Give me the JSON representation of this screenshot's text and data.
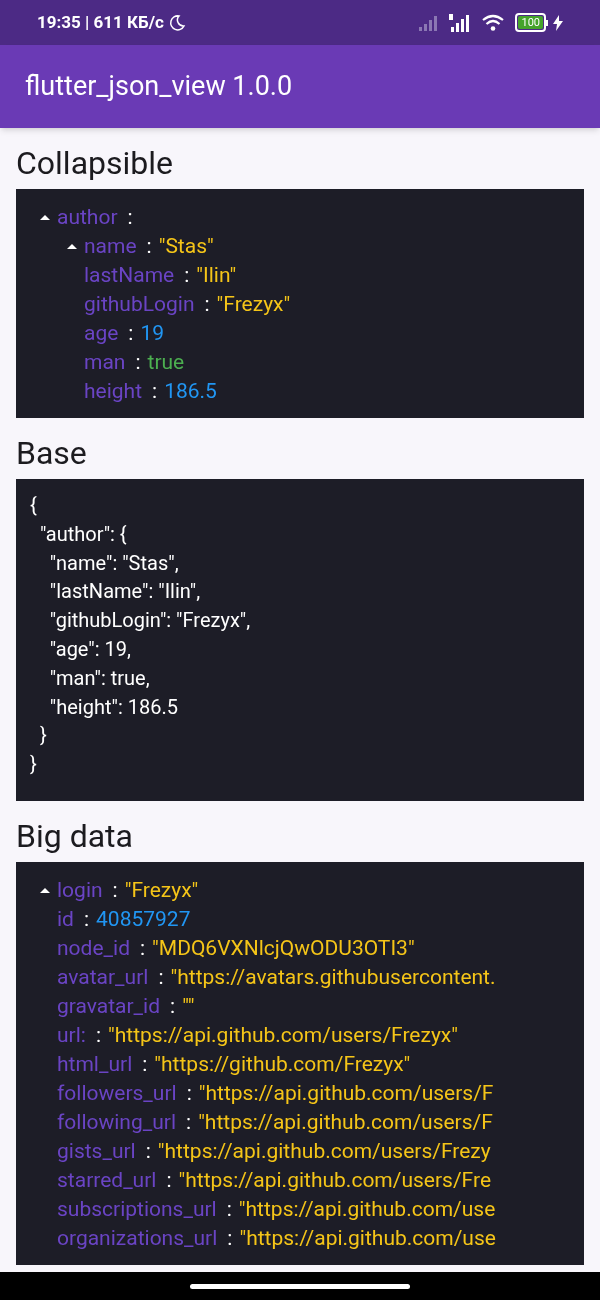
{
  "status_bar": {
    "time": "19:35 | 611 КБ/с",
    "battery": "100"
  },
  "app_bar": {
    "title": "flutter_json_view 1.0.0"
  },
  "sections": [
    {
      "title": "Collapsible",
      "kind": "tree",
      "nodes": [
        {
          "key": "author",
          "separator": ":",
          "expanded": true,
          "children": [
            {
              "key": "name",
              "separator": ":",
              "expanded": true,
              "value": "\"Stas\"",
              "color": "#f5c518"
            },
            {
              "key": "lastName",
              "separator": ":",
              "value": "\"Ilin\"",
              "color": "#f5c518"
            },
            {
              "key": "githubLogin",
              "separator": ":",
              "value": "\"Frezyx\"",
              "color": "#f5c518"
            },
            {
              "key": "age",
              "separator": ":",
              "value": "19",
              "color": "#2196f3"
            },
            {
              "key": "man",
              "separator": ":",
              "value": "true",
              "color": "#4caf50"
            },
            {
              "key": "height",
              "separator": ":",
              "value": "186.5",
              "color": "#2196f3"
            }
          ]
        }
      ]
    },
    {
      "title": "Base",
      "kind": "text",
      "lines": [
        "{",
        "  \"author\": {",
        "    \"name\": \"Stas\",",
        "    \"lastName\": \"Ilin\",",
        "    \"githubLogin\": \"Frezyx\",",
        "    \"age\": 19,",
        "    \"man\": true,",
        "    \"height\": 186.5",
        "  }",
        "}"
      ]
    },
    {
      "title": "Big data",
      "kind": "tree",
      "nodes": [
        {
          "key": "login",
          "separator": ":",
          "expanded": true,
          "value": "\"Frezyx\"",
          "color": "#f5c518"
        },
        {
          "key": "id",
          "separator": ":",
          "value": "40857927",
          "color": "#2196f3"
        },
        {
          "key": "node_id",
          "separator": ":",
          "value": "\"MDQ6VXNlcjQwODU3OTI3\"",
          "color": "#f5c518"
        },
        {
          "key": "avatar_url",
          "separator": ":",
          "value": "\"https://avatars.githubusercontent.",
          "color": "#f5c518"
        },
        {
          "key": "gravatar_id",
          "separator": ":",
          "value": "\"\"",
          "color": "#f5c518"
        },
        {
          "key": "url:",
          "separator": ":",
          "value": "\"https://api.github.com/users/Frezyx\"",
          "color": "#f5c518"
        },
        {
          "key": "html_url",
          "separator": ":",
          "value": "\"https://github.com/Frezyx\"",
          "color": "#f5c518"
        },
        {
          "key": "followers_url",
          "separator": ":",
          "value": "\"https://api.github.com/users/F",
          "color": "#f5c518"
        },
        {
          "key": "following_url",
          "separator": ":",
          "value": "\"https://api.github.com/users/F",
          "color": "#f5c518"
        },
        {
          "key": "gists_url",
          "separator": ":",
          "value": "\"https://api.github.com/users/Frezy",
          "color": "#f5c518"
        },
        {
          "key": "starred_url",
          "separator": ":",
          "value": "\"https://api.github.com/users/Fre",
          "color": "#f5c518"
        },
        {
          "key": "subscriptions_url",
          "separator": ":",
          "value": "\"https://api.github.com/use",
          "color": "#f5c518"
        },
        {
          "key": "organizations_url",
          "separator": ":",
          "value": "\"https://api.github.com/use",
          "color": "#f5c518"
        }
      ]
    }
  ]
}
